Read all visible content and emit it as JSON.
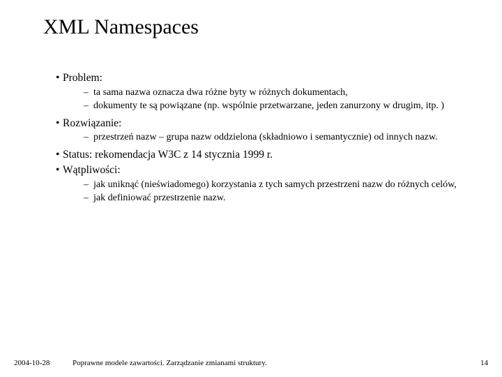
{
  "title": "XML Namespaces",
  "bullets": {
    "b0": {
      "label": "Problem:"
    },
    "b0s": [
      "ta sama nazwa oznacza dwa różne byty w różnych dokumentach,",
      "dokumenty te są powiązane (np. wspólnie przetwarzane, jeden zanurzony w drugim, itp. )"
    ],
    "b1": {
      "label": "Rozwiązanie:"
    },
    "b1s": [
      "przestrzeń nazw – grupa nazw oddzielona (składniowo i semantycznie) od innych nazw."
    ],
    "b2": {
      "label": "Status: rekomendacja W3C z 14 stycznia 1999 r."
    },
    "b3": {
      "label": "Wątpliwości:"
    },
    "b3s": [
      "jak uniknąć (nieświadomego) korzystania z tych samych przestrzeni nazw do różnych celów,",
      "jak definiować przestrzenie nazw."
    ]
  },
  "footer": {
    "date": "2004-10-28",
    "title": "Poprawne modele zawartości. Zarządzanie zmianami struktury.",
    "page": "14"
  }
}
